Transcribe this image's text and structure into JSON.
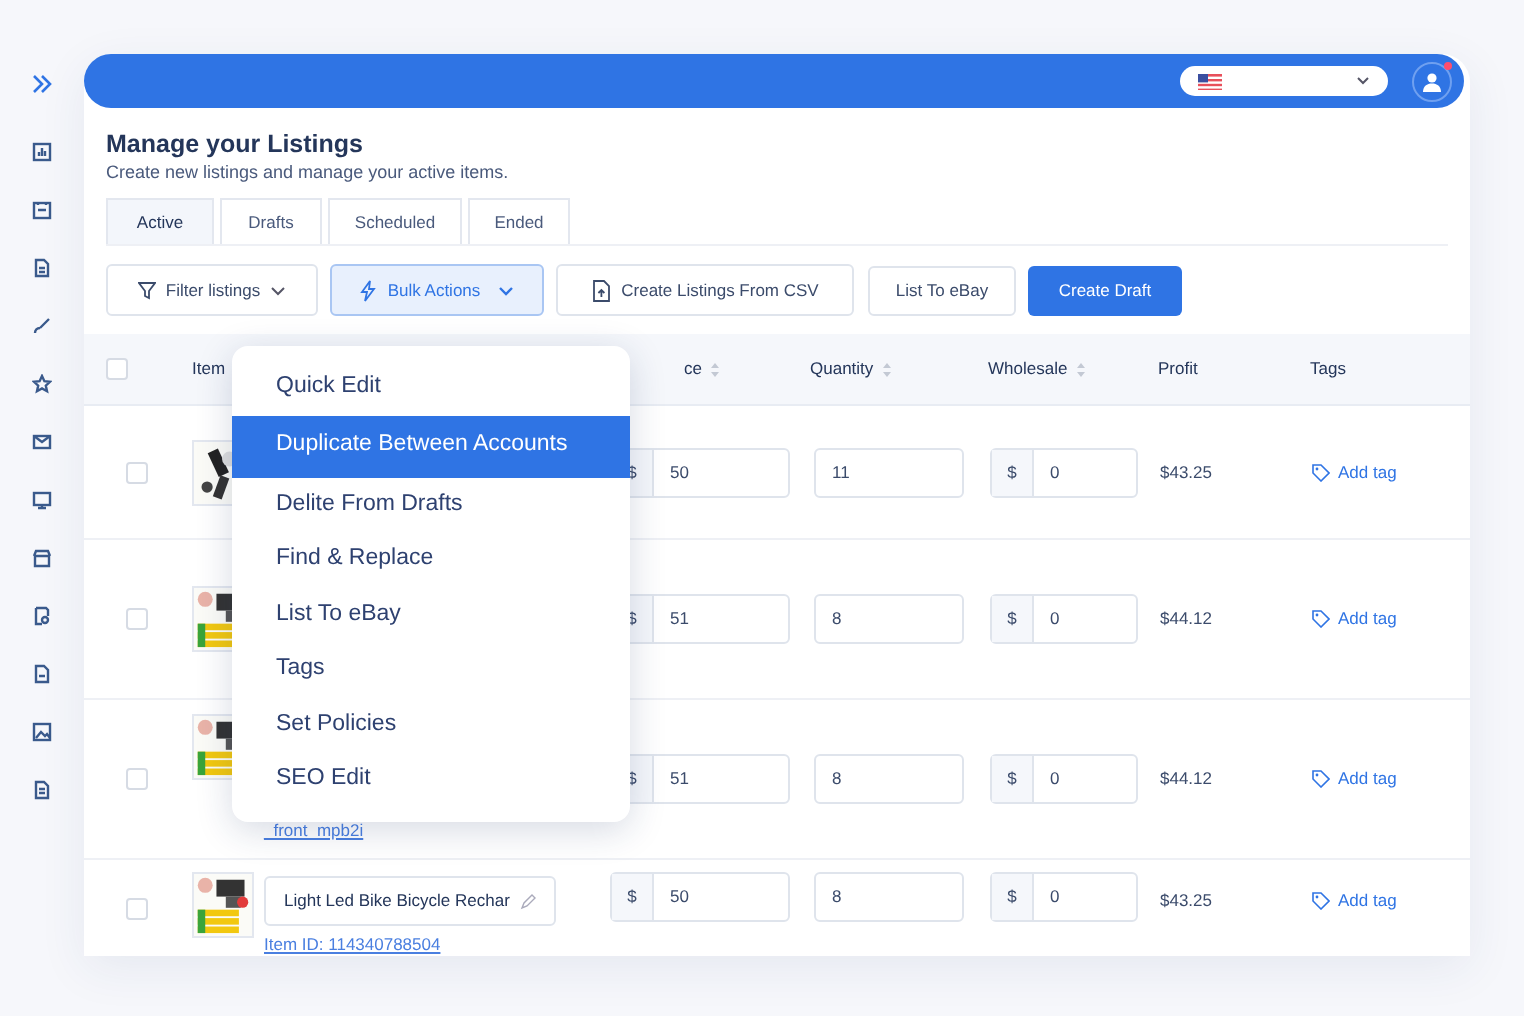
{
  "topbar": {
    "account": {
      "has_notification": true
    }
  },
  "header": {
    "title": "Manage your Listings",
    "subtitle": "Create new listings and manage your active items."
  },
  "tabs": [
    {
      "label": "Active",
      "selected": true
    },
    {
      "label": "Drafts",
      "selected": false
    },
    {
      "label": "Scheduled",
      "selected": false
    },
    {
      "label": "Ended",
      "selected": false
    }
  ],
  "toolbar": [
    {
      "kind": "filter",
      "label": "Filter listings"
    },
    {
      "kind": "bulk",
      "label": "Bulk Actions",
      "expanded": true
    },
    {
      "kind": "csv",
      "label": "Create Listings From CSV"
    },
    {
      "kind": "plain",
      "label": "List To eBay"
    },
    {
      "kind": "primary",
      "label": "Create Draft"
    }
  ],
  "bulk_menu": {
    "items": [
      {
        "label": "Quick Edit",
        "selected": false
      },
      {
        "label": "Duplicate Between Accounts",
        "selected": true
      },
      {
        "label": "Delite From Drafts",
        "selected": false
      },
      {
        "label": "Find & Replace",
        "selected": false
      },
      {
        "label": "List To eBay",
        "selected": false
      },
      {
        "label": "Tags",
        "selected": false
      },
      {
        "label": "Set Policies",
        "selected": false
      },
      {
        "label": "SEO Edit",
        "selected": false
      }
    ]
  },
  "table": {
    "select_all_checked": false,
    "columns": [
      {
        "label": "Item"
      },
      {
        "label": "ce",
        "sortable": true
      },
      {
        "label": "Quantity",
        "sortable": true
      },
      {
        "label": "Wholesale",
        "sortable": true
      },
      {
        "label": "Profit",
        "sortable": false
      },
      {
        "label": "Tags",
        "sortable": false
      }
    ],
    "rows": [
      {
        "checked": false,
        "price_currency": "$",
        "price": "50",
        "quantity": "11",
        "wholesale_currency": "$",
        "wholesale": "0",
        "profit": "$43.25",
        "tag_action": "Add tag"
      },
      {
        "checked": false,
        "price_currency": "$",
        "price": "51",
        "quantity": "8",
        "wholesale_currency": "$",
        "wholesale": "0",
        "profit": "$44.12",
        "tag_action": "Add tag"
      },
      {
        "checked": false,
        "item_link": "_front_mpb2i",
        "price_currency": "$",
        "price": "51",
        "quantity": "8",
        "wholesale_currency": "$",
        "wholesale": "0",
        "profit": "$44.12",
        "tag_action": "Add tag"
      },
      {
        "checked": false,
        "title": "Light Led Bike Bicycle Rechar",
        "item_id": "Item ID: 114340788504",
        "price_currency": "$",
        "price": "50",
        "quantity": "8",
        "wholesale_currency": "$",
        "wholesale": "0",
        "profit": "$43.25",
        "tag_action": "Add tag"
      }
    ]
  }
}
